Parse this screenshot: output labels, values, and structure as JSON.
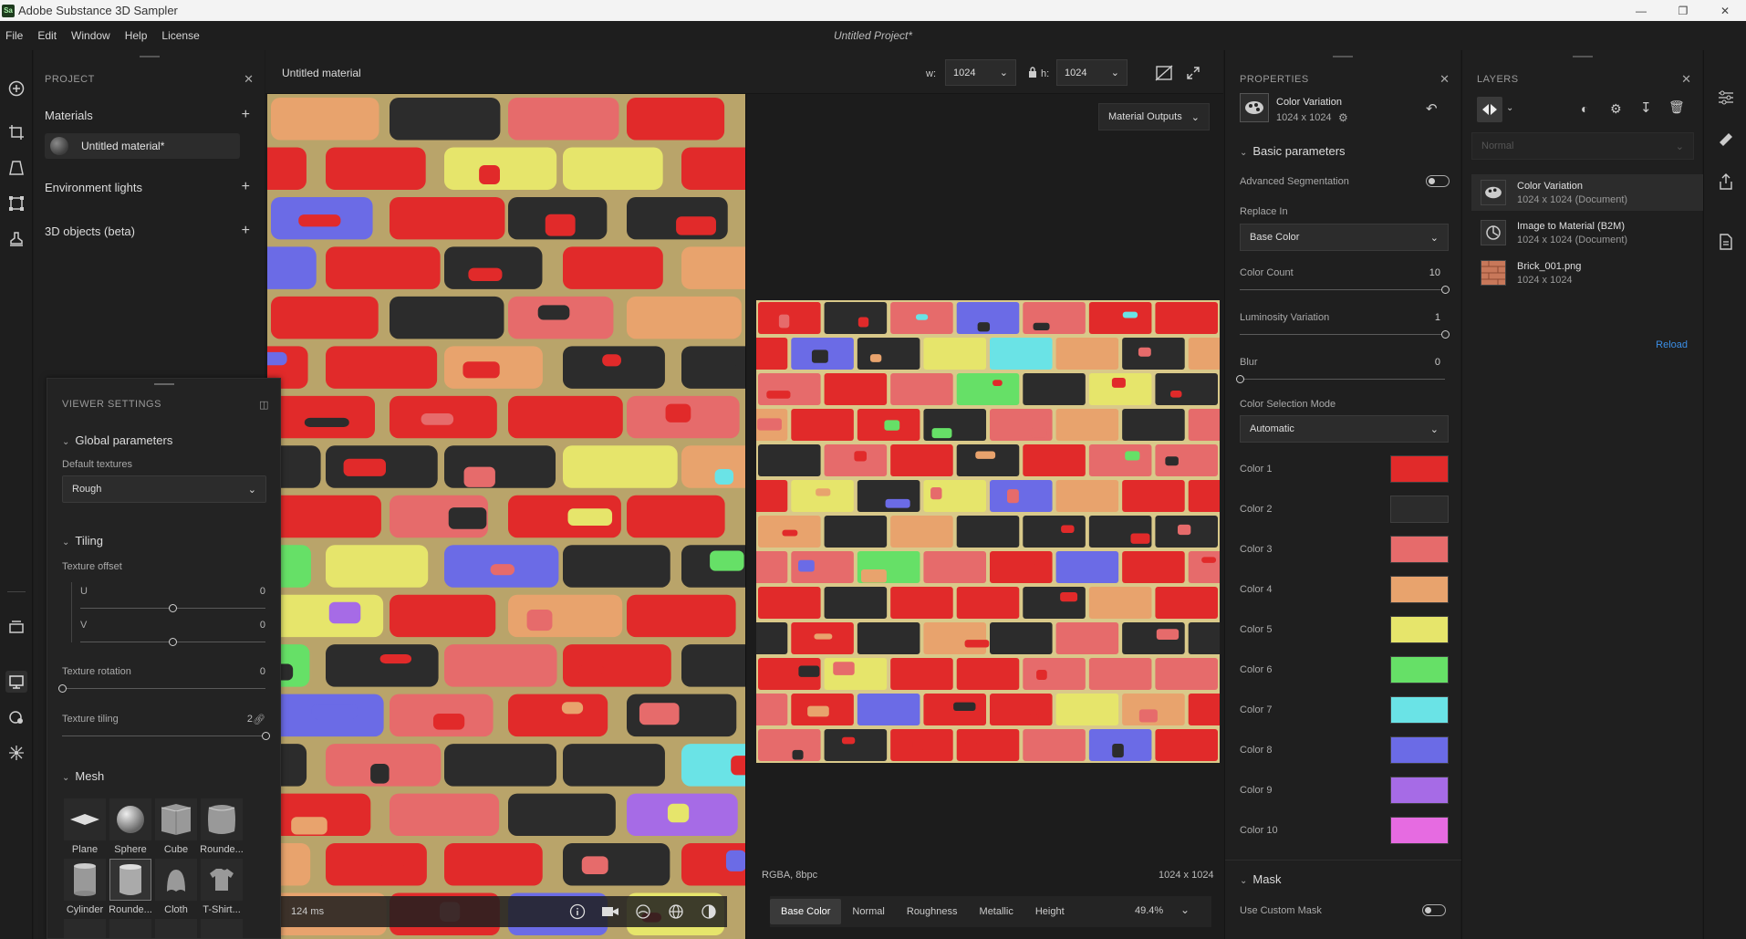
{
  "window": {
    "app_title": "Adobe Substance 3D Sampler",
    "logo_text": "Sa",
    "project_title": "Untitled Project*"
  },
  "menu": [
    "File",
    "Edit",
    "Window",
    "Help",
    "License"
  ],
  "project": {
    "header": "PROJECT",
    "sections": {
      "materials": "Materials",
      "env_lights": "Environment lights",
      "objects": "3D objects (beta)"
    },
    "material_item": "Untitled material*"
  },
  "viewer_settings": {
    "header": "VIEWER SETTINGS",
    "global_params": "Global parameters",
    "default_textures_label": "Default textures",
    "default_textures_value": "Rough",
    "tiling": "Tiling",
    "texture_offset": "Texture offset",
    "u_label": "U",
    "u_value": "0",
    "u_level": 0.5,
    "v_label": "V",
    "v_value": "0",
    "v_level": 0.5,
    "rotation_label": "Texture rotation",
    "rotation_value": "0",
    "rotation_level": 0,
    "tiling_label": "Texture tiling",
    "tiling_value": "2",
    "tiling_level": 1,
    "mesh": "Mesh",
    "meshes": [
      "Plane",
      "Sphere",
      "Cube",
      "Rounde...",
      "Cylinder",
      "Rounde...",
      "Cloth",
      "T-Shirt..."
    ]
  },
  "viewport": {
    "title": "Untitled material",
    "w_label": "w:",
    "w_value": "1024",
    "h_label": "h:",
    "h_value": "1024",
    "material_outputs": "Material Outputs",
    "tex_format": "RGBA, 8bpc",
    "tex_size": "1024 x 1024",
    "render_time": "124 ms",
    "channels": [
      "Base Color",
      "Normal",
      "Roughness",
      "Metallic",
      "Height"
    ],
    "zoom": "49.4%"
  },
  "properties": {
    "header": "PROPERTIES",
    "layer_name": "Color Variation",
    "layer_size": "1024 x 1024",
    "basic_params": "Basic parameters",
    "adv_seg": "Advanced Segmentation",
    "replace_in_label": "Replace In",
    "replace_in_value": "Base Color",
    "color_count_label": "Color Count",
    "color_count_value": "10",
    "color_count_level": 1,
    "lum_var_label": "Luminosity Variation",
    "lum_var_value": "1",
    "lum_var_level": 1,
    "blur_label": "Blur",
    "blur_value": "0",
    "blur_level": 0,
    "csm_label": "Color Selection Mode",
    "csm_value": "Automatic",
    "colors": [
      {
        "label": "Color 1",
        "hex": "#e12a2a"
      },
      {
        "label": "Color 2",
        "hex": "#2c2c2c"
      },
      {
        "label": "Color 3",
        "hex": "#e66b6b"
      },
      {
        "label": "Color 4",
        "hex": "#e8a36d"
      },
      {
        "label": "Color 5",
        "hex": "#e6e56b"
      },
      {
        "label": "Color 6",
        "hex": "#66e067"
      },
      {
        "label": "Color 7",
        "hex": "#6ae3e6"
      },
      {
        "label": "Color 8",
        "hex": "#6b6be6"
      },
      {
        "label": "Color 9",
        "hex": "#a66be6"
      },
      {
        "label": "Color 10",
        "hex": "#e66be1"
      }
    ],
    "mask": "Mask",
    "custom_mask": "Use Custom Mask"
  },
  "layers": {
    "header": "LAYERS",
    "blend_mode": "Normal",
    "items": [
      {
        "name": "Color Variation",
        "sub": "1024 x 1024 (Document)"
      },
      {
        "name": "Image to Material (B2M)",
        "sub": "1024 x 1024 (Document)"
      },
      {
        "name": "Brick_001.png",
        "sub": "1024 x 1024"
      }
    ],
    "reload": "Reload"
  }
}
